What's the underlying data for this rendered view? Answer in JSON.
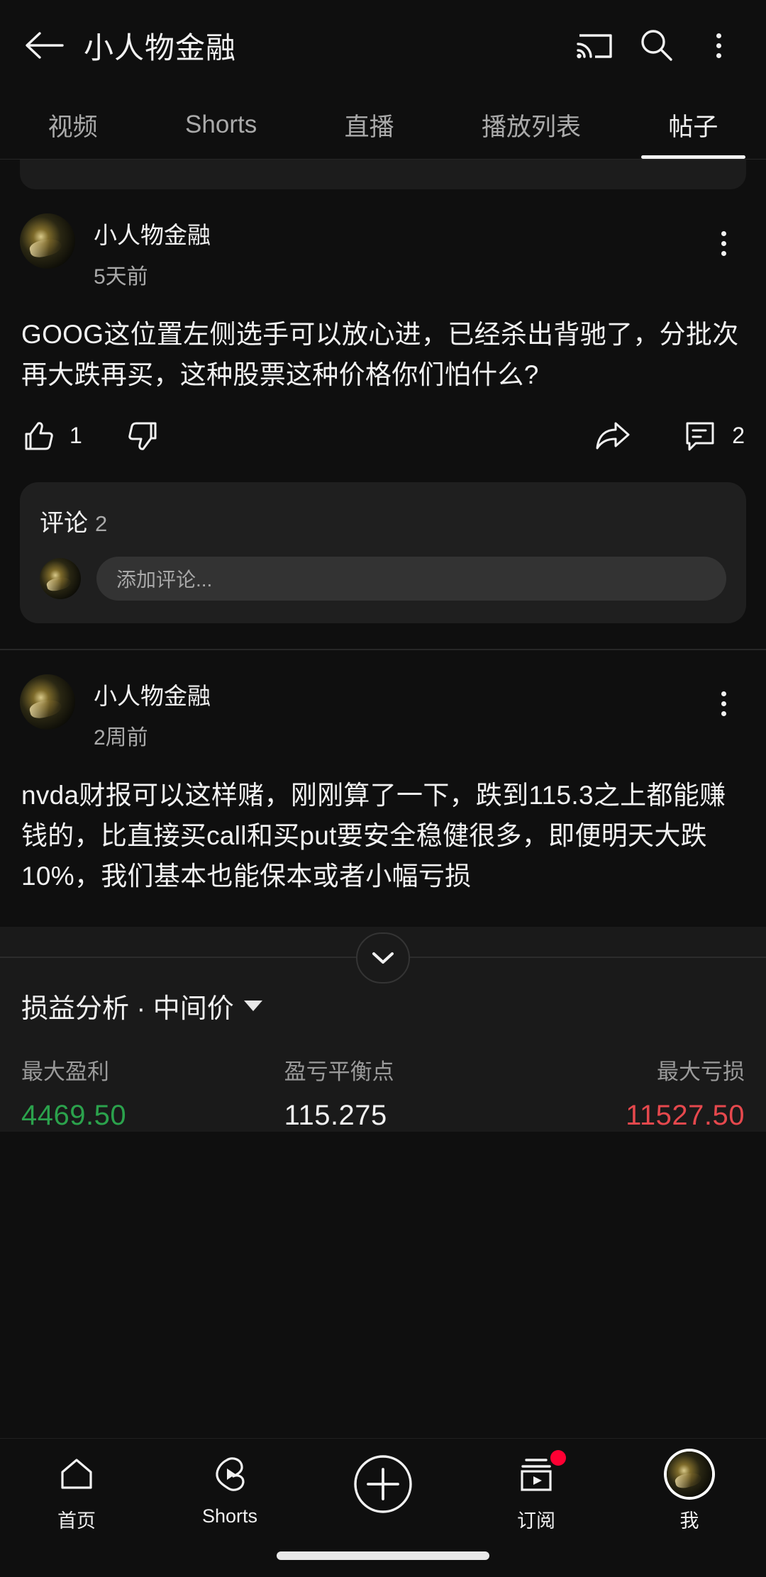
{
  "appbar": {
    "back_icon": "arrow-left-icon",
    "title": "小人物金融",
    "cast_icon": "cast-icon",
    "search_icon": "search-icon",
    "overflow_icon": "kebab-menu-icon"
  },
  "tabs": [
    {
      "label": "视频",
      "active": false
    },
    {
      "label": "Shorts",
      "active": false
    },
    {
      "label": "直播",
      "active": false
    },
    {
      "label": "播放列表",
      "active": false
    },
    {
      "label": "帖子",
      "active": true
    }
  ],
  "posts": [
    {
      "author": "小人物金融",
      "time": "5天前",
      "text": "GOOG这位置左侧选手可以放心进，已经杀出背驰了，分批次再大跌再买，这种股票这种价格你们怕什么?",
      "like_count": "1",
      "dislike_count": "",
      "comment_count": "2",
      "like_icon": "thumbs-up-icon",
      "dislike_icon": "thumbs-down-icon",
      "share_icon": "share-arrow-icon",
      "comment_icon": "comment-bubble-icon",
      "comments": {
        "heading": "评论",
        "count": "2",
        "input_placeholder": "添加评论..."
      }
    },
    {
      "author": "小人物金融",
      "time": "2周前",
      "text": "nvda财报可以这样赌，刚刚算了一下，跌到115.3之上都能赚钱的，比直接买call和买put要安全稳健很多，即便明天大跌10%，我们基本也能保本或者小幅亏损"
    }
  ],
  "attachment": {
    "expand_icon": "chevron-down-icon",
    "title": "损益分析 · 中间价",
    "dropdown_icon": "caret-down-icon",
    "stats": [
      {
        "label": "最大盈利",
        "value": "4469.50",
        "color": "#2ba24c"
      },
      {
        "label": "盈亏平衡点",
        "value": "115.275",
        "color": "#f1f1f1"
      },
      {
        "label": "最大亏损",
        "value": "11527.50",
        "color": "#e5484d"
      }
    ]
  },
  "bottomnav": [
    {
      "label": "首页",
      "icon": "home-icon",
      "badge": false
    },
    {
      "label": "Shorts",
      "icon": "shorts-icon",
      "badge": false
    },
    {
      "label": "",
      "icon": "create-plus-icon",
      "badge": false
    },
    {
      "label": "订阅",
      "icon": "subscriptions-icon",
      "badge": true
    },
    {
      "label": "我",
      "icon": "account-avatar-icon",
      "badge": false
    }
  ]
}
